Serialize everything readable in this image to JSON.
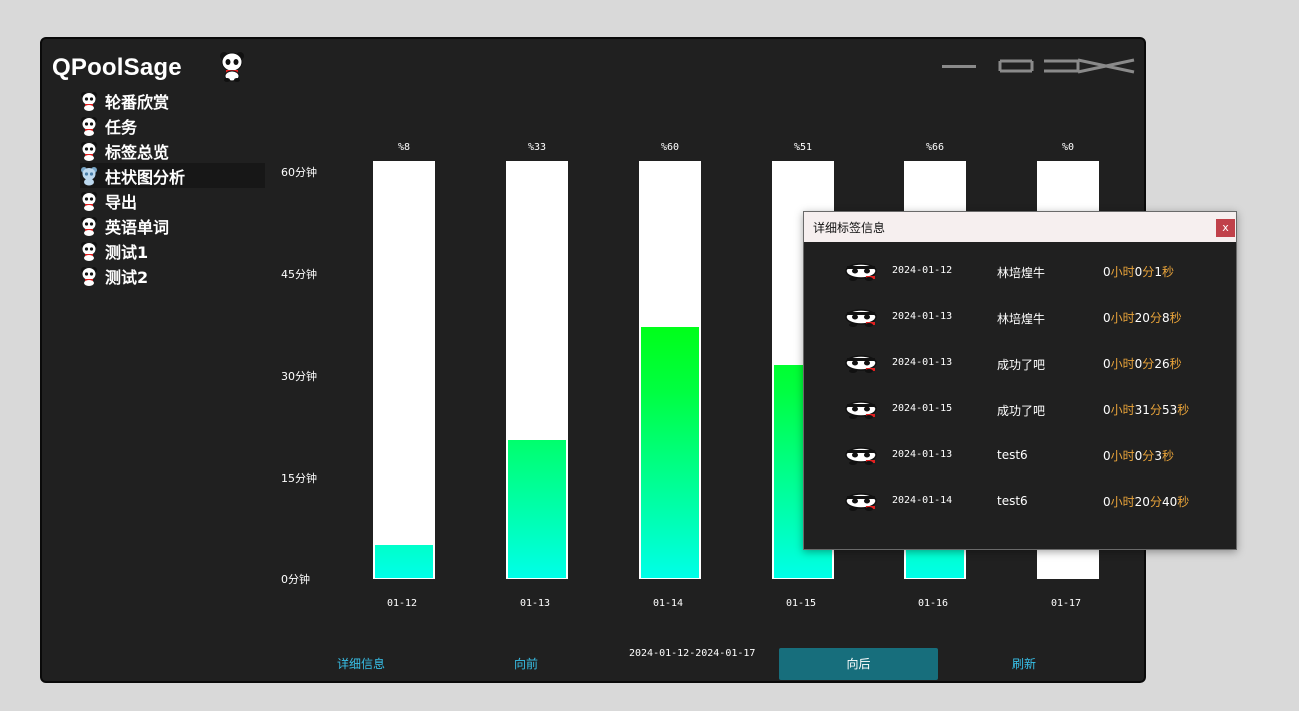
{
  "app": {
    "title": "QPoolSage"
  },
  "sidebar": {
    "items": [
      {
        "label": "轮番欣赏",
        "active": false
      },
      {
        "label": "任务",
        "active": false
      },
      {
        "label": "标签总览",
        "active": false
      },
      {
        "label": "柱状图分析",
        "active": true
      },
      {
        "label": "导出",
        "active": false
      },
      {
        "label": "英语单词",
        "active": false
      },
      {
        "label": "测试1",
        "active": false
      },
      {
        "label": "测试2",
        "active": false
      }
    ]
  },
  "chart_data": {
    "type": "bar",
    "categories": [
      "01-12",
      "01-13",
      "01-14",
      "01-15",
      "01-16",
      "01-17"
    ],
    "values": [
      4.8,
      19.8,
      36,
      30.6,
      39.6,
      0
    ],
    "percent_labels": [
      "%8",
      "%33",
      "%60",
      "%51",
      "%66",
      "%0"
    ],
    "ytick_labels": [
      "60分钟",
      "45分钟",
      "30分钟",
      "15分钟",
      "0分钟"
    ],
    "ylim": [
      0,
      60
    ],
    "unit": "分钟",
    "colors": {
      "bar_background": "#ffffff",
      "gradient_bottom": "#00ffe8",
      "gradient_mid": "#00ff00",
      "gradient_top": "#b8ff00"
    }
  },
  "footer": {
    "detail_label": "详细信息",
    "prev_label": "向前",
    "date_range": "2024-01-12-2024-01-17",
    "next_label": "向后",
    "refresh_label": "刷新"
  },
  "dialog": {
    "title": "详细标签信息",
    "close_label": "x",
    "rows": [
      {
        "date": "2024-01-12",
        "name": "林培煌牛",
        "h": "0",
        "m": "0",
        "s": "1"
      },
      {
        "date": "2024-01-13",
        "name": "林培煌牛",
        "h": "0",
        "m": "20",
        "s": "8"
      },
      {
        "date": "2024-01-13",
        "name": "成功了吧",
        "h": "0",
        "m": "0",
        "s": "26"
      },
      {
        "date": "2024-01-15",
        "name": "成功了吧",
        "h": "0",
        "m": "31",
        "s": "53"
      },
      {
        "date": "2024-01-13",
        "name": "test6",
        "h": "0",
        "m": "0",
        "s": "3"
      },
      {
        "date": "2024-01-14",
        "name": "test6",
        "h": "0",
        "m": "20",
        "s": "40"
      }
    ],
    "units": {
      "hour": "小时",
      "minute": "分",
      "second": "秒"
    }
  },
  "colors": {
    "accent": "#176e7c",
    "link": "#38c0e8",
    "duration": "#e8a33a",
    "close": "#c0414a"
  }
}
